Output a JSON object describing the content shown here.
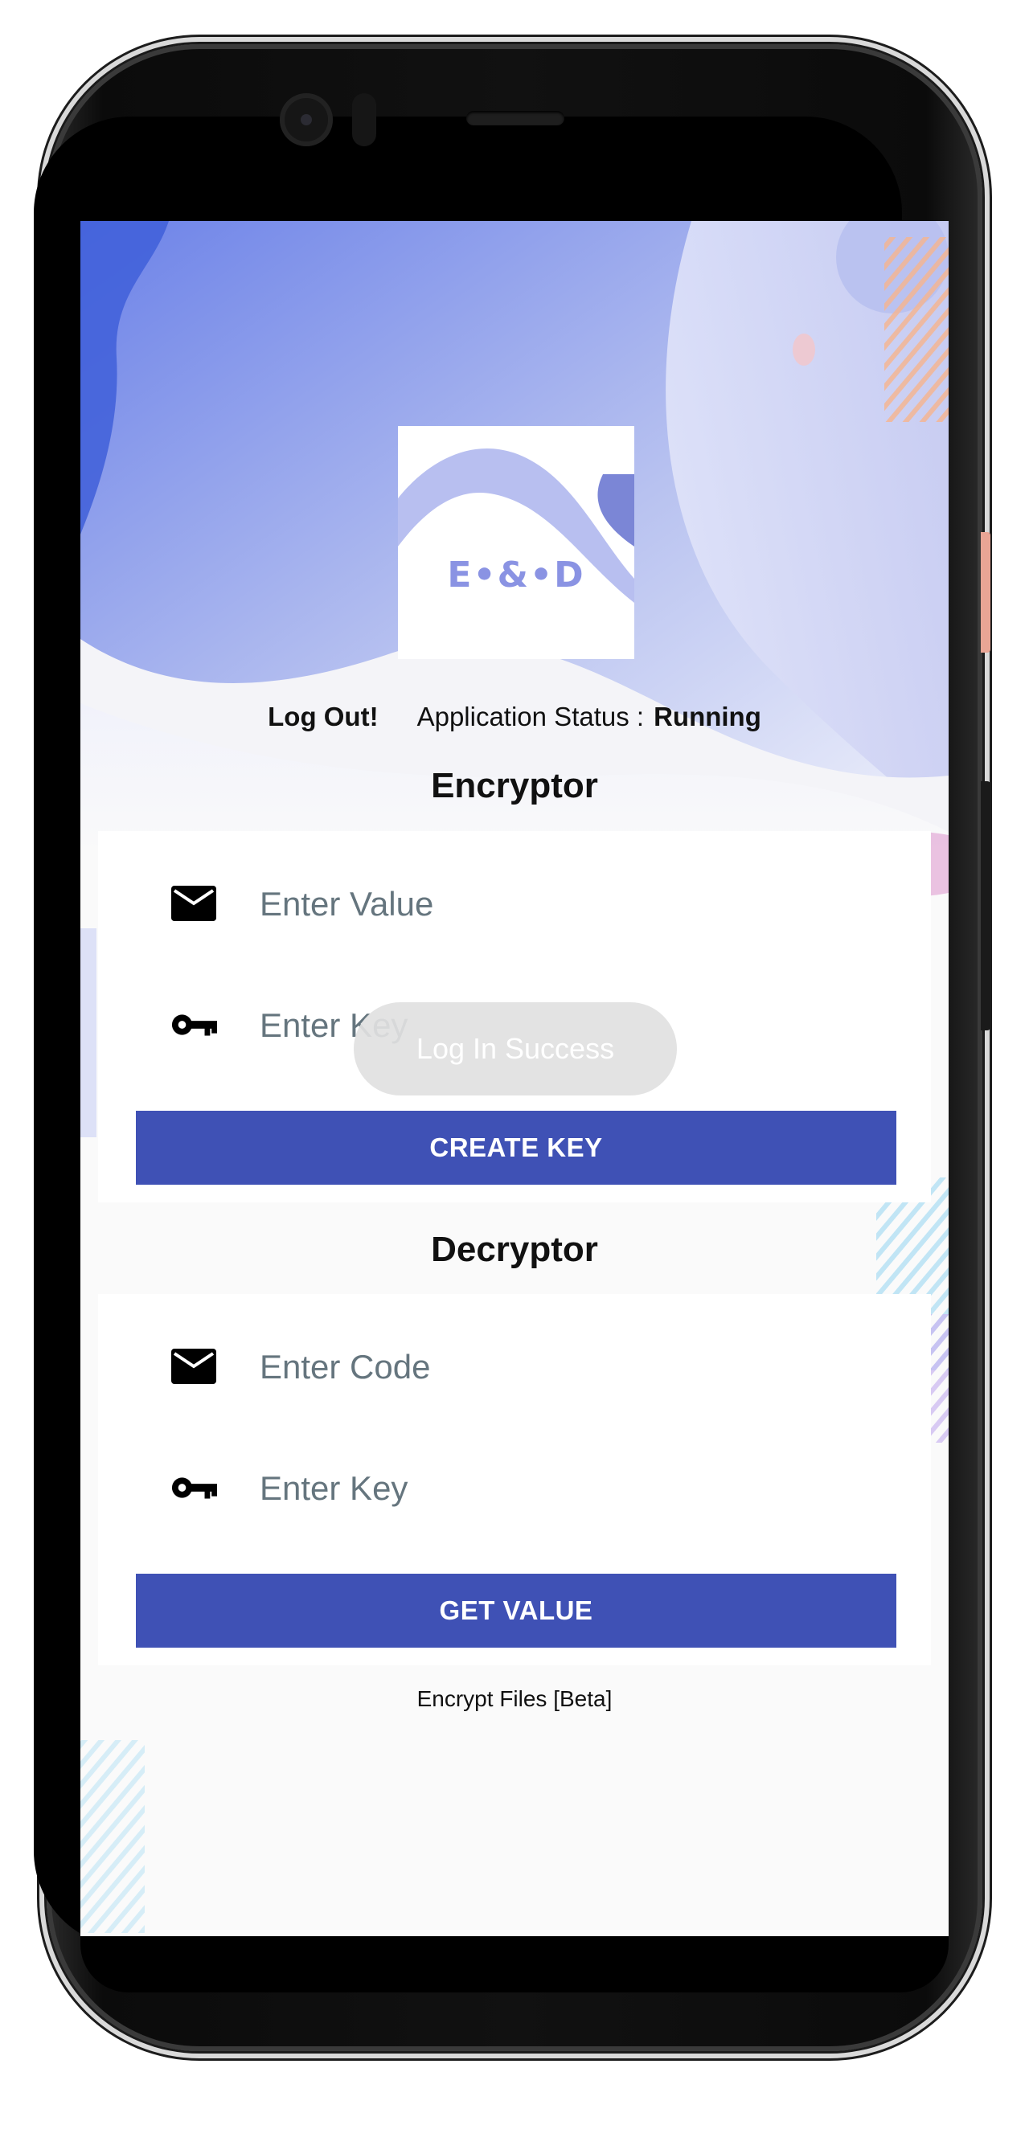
{
  "logo": {
    "text": "E•&•D"
  },
  "status_bar": {
    "logout_label": "Log Out!",
    "status_label": "Application Status :",
    "status_value": "Running"
  },
  "encryptor": {
    "title": "Encryptor",
    "value_placeholder": "Enter Value",
    "key_placeholder": "Enter Key",
    "button_label": "CREATE KEY"
  },
  "decryptor": {
    "title": "Decryptor",
    "code_placeholder": "Enter Code",
    "key_placeholder": "Enter Key",
    "button_label": "GET VALUE"
  },
  "footer": {
    "encrypt_files_label": "Encrypt Files [Beta]"
  },
  "toast": {
    "message": "Log In Success"
  },
  "icons": {
    "value": "mail-icon",
    "key": "key-icon"
  },
  "colors": {
    "accent": "#3f51b5",
    "placeholder": "#65757e",
    "background": "#fafafa"
  }
}
